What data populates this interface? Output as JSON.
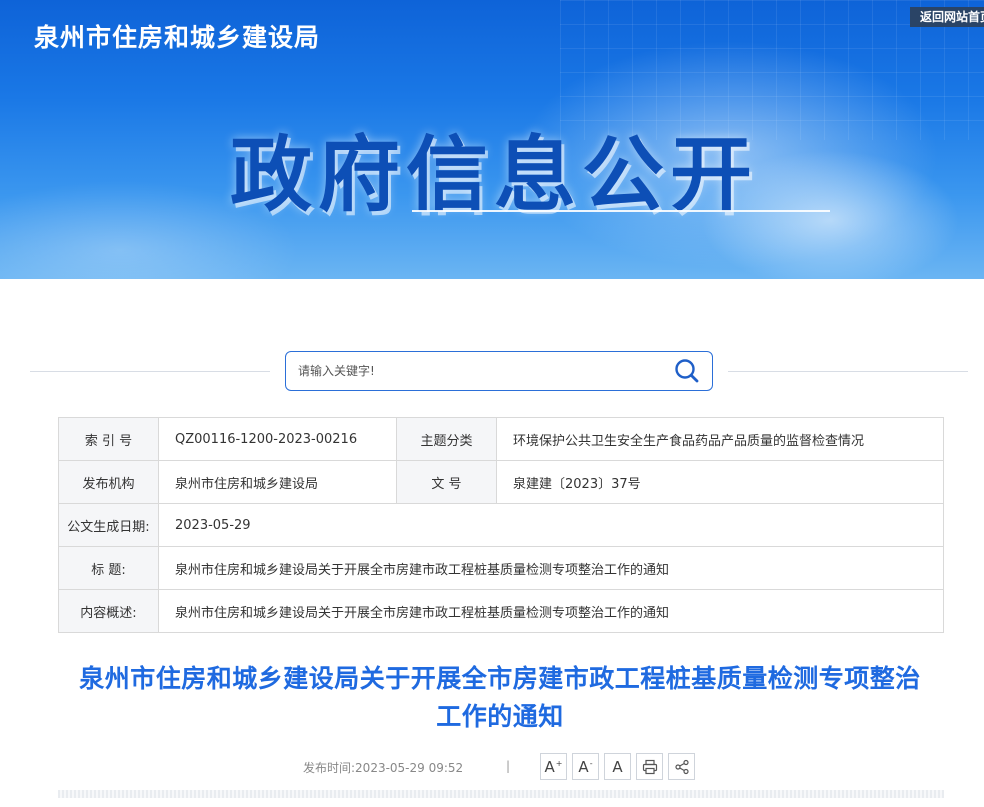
{
  "header": {
    "site_title": "泉州市住房和城乡建设局",
    "home_link": "返回网站首页",
    "banner_heading": "政府信息公开"
  },
  "search": {
    "placeholder": "请输入关键字!",
    "icon": "search-icon"
  },
  "info": {
    "index_label": "索 引 号",
    "index_value": "QZ00116-1200-2023-00216",
    "topic_label": "主题分类",
    "topic_value": "环境保护公共卫生安全生产食品药品产品质量的监督检查情况",
    "issuer_label": "发布机构",
    "issuer_value": "泉州市住房和城乡建设局",
    "docno_label": "文 号",
    "docno_value": "泉建建〔2023〕37号",
    "date_label": "公文生成日期:",
    "date_value": "2023-05-29",
    "title_label": "标 题:",
    "title_value": "泉州市住房和城乡建设局关于开展全市房建市政工程桩基质量检测专项整治工作的通知",
    "summary_label": "内容概述:",
    "summary_value": "泉州市住房和城乡建设局关于开展全市房建市政工程桩基质量检测专项整治工作的通知"
  },
  "article": {
    "title_line1": "泉州市住房和城乡建设局关于开展全市房建市政工程桩基质量检测专项整治",
    "title_line2": "工作的通知",
    "publish_label": "发布时间:",
    "publish_time": "2023-05-29 09:52",
    "separator": "|"
  },
  "tools": {
    "font_increase": "A",
    "font_increase_sup": "+",
    "font_decrease": "A",
    "font_decrease_sup": "-",
    "font_reset": "A",
    "icons": [
      "font-increase-icon",
      "font-decrease-icon",
      "font-reset-icon",
      "print-icon",
      "share-icon"
    ]
  },
  "colors": {
    "brand_blue": "#1f6ae0",
    "search_border": "#2b6fd8"
  }
}
